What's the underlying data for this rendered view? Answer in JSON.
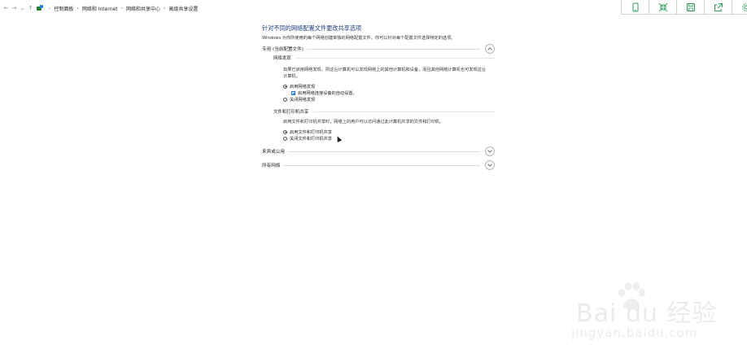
{
  "addressbar": {
    "nav": {
      "back": "←",
      "forward": "→",
      "recent": "⌄",
      "up": "↑"
    },
    "breadcrumb": [
      "控制面板",
      "网络和 Internet",
      "网络和共享中心",
      "高级共享设置"
    ],
    "separator": "›"
  },
  "toolbar": {
    "buttons": [
      "phone-icon",
      "collapse-icon",
      "save-icon",
      "share-icon",
      "settings-icon"
    ]
  },
  "main": {
    "title": "针对不同的网络配置文件更改共享选项",
    "description": "Windows 为你所使用的每个网络创建单独的网络配置文件。你可以针对每个配置文件选择特定的选项。",
    "profiles": [
      {
        "label": "专用 (当前配置文件)",
        "expanded": true,
        "groups": [
          {
            "heading": "网络发现",
            "text": "如果已启用网络发现，则这台计算机可以发现网络上的其他计算机和设备，而且其他网络计算机也可发现这台计算机。",
            "options": [
              {
                "type": "radio",
                "label": "启用网络发现",
                "checked": true
              },
              {
                "type": "checkbox",
                "label": "启用网络连接设备的自动设置。",
                "checked": true,
                "indent": true
              },
              {
                "type": "radio",
                "label": "关闭网络发现",
                "checked": false
              }
            ]
          },
          {
            "heading": "文件和打印机共享",
            "text": "启用文件和打印机共享时，网络上的用户可以访问通过此计算机共享的文件和打印机。",
            "options": [
              {
                "type": "radio",
                "label": "启用文件和打印机共享",
                "checked": true
              },
              {
                "type": "radio",
                "label": "关闭文件和打印机共享",
                "checked": false
              }
            ]
          }
        ]
      },
      {
        "label": "来宾或公用",
        "expanded": false
      },
      {
        "label": "所有网络",
        "expanded": false
      }
    ]
  },
  "watermark": {
    "brand": "Bai du 经验",
    "url": "jingyan.baidu.com"
  }
}
